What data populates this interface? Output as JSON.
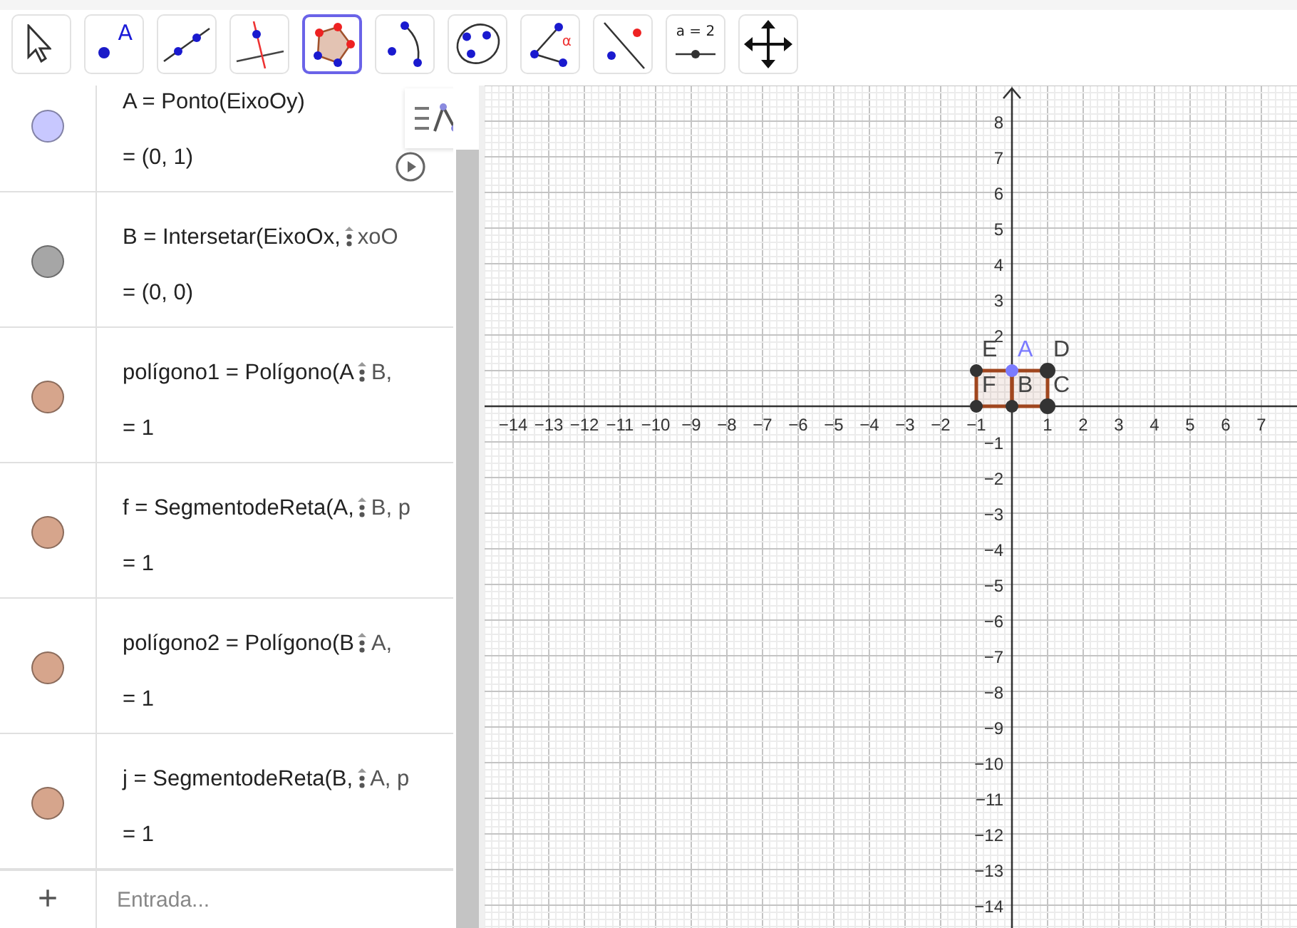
{
  "toolbar": [
    {
      "kind": "pointer",
      "selected": false
    },
    {
      "kind": "point",
      "label": "A",
      "selected": false
    },
    {
      "kind": "line",
      "selected": false
    },
    {
      "kind": "perpendicular",
      "selected": false
    },
    {
      "kind": "polygon",
      "selected": true
    },
    {
      "kind": "arc",
      "selected": false
    },
    {
      "kind": "conic",
      "selected": false
    },
    {
      "kind": "angle",
      "label": "α",
      "selected": false
    },
    {
      "kind": "reflect",
      "selected": false
    },
    {
      "kind": "slider",
      "label": "a = 2",
      "selected": false
    },
    {
      "kind": "move",
      "selected": false
    }
  ],
  "algebra": {
    "rows": [
      {
        "before": "A = Ponto(EixoOy)",
        "value": "= (0, 1)",
        "color": "#c8c8ff",
        "play": true
      },
      {
        "before": "B = Intersetar(EixoOx, ",
        "after": "xoO",
        "value": "= (0, 0)",
        "color": "#a6a6a6"
      },
      {
        "before": "polígono1 = Polígono(A",
        "after": "B,",
        "value": "= 1",
        "color": "#d6a58c"
      },
      {
        "before": "f = SegmentodeReta(A, ",
        "after": "B, p",
        "value": "= 1",
        "color": "#d6a58c"
      },
      {
        "before": "polígono2 = Polígono(B",
        "after": "A,",
        "value": "= 1",
        "color": "#d6a58c"
      },
      {
        "before": "j = SegmentodeReta(B, ",
        "after": "A, p",
        "value": "= 1",
        "color": "#d6a58c"
      }
    ],
    "input": {
      "button": "+",
      "placeholder": "Entrada..."
    }
  },
  "graphics": {
    "x_labels": [
      "−14",
      "−13",
      "−12",
      "−11",
      "−10",
      "−9",
      "−8",
      "−7",
      "−6",
      "−5",
      "−4",
      "−3",
      "−2",
      "−1",
      "1",
      "2",
      "3",
      "4",
      "5",
      "6",
      "7"
    ],
    "y_labels": [
      "8",
      "7",
      "6",
      "5",
      "4",
      "3",
      "2",
      "−1",
      "−2",
      "−3",
      "−4",
      "−5",
      "−6",
      "−7",
      "−8",
      "−9",
      "−10",
      "−11",
      "−12",
      "−13",
      "−14"
    ],
    "points": [
      {
        "label": "E",
        "color": "#333333"
      },
      {
        "label": "A",
        "color": "#7b7bff"
      },
      {
        "label": "D",
        "color": "#333333"
      },
      {
        "label": "F",
        "color": "#333333"
      },
      {
        "label": "B",
        "color": "#333333"
      },
      {
        "label": "C",
        "color": "#333333"
      }
    ]
  }
}
